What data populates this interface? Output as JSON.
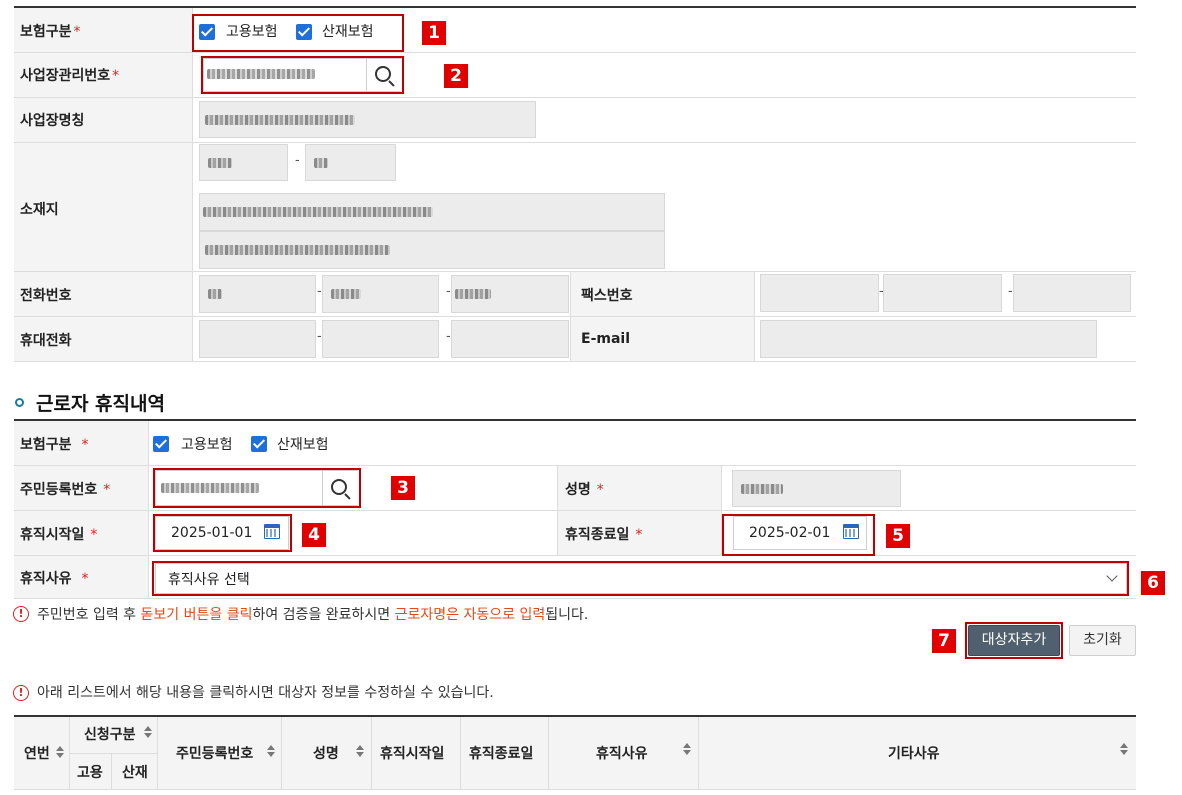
{
  "form1": {
    "insurance_type_label": "보험구분",
    "insurance_options": [
      "고용보험",
      "산재보험"
    ],
    "biz_no_label": "사업장관리번호",
    "biz_name_label": "사업장명칭",
    "address_label": "소재지",
    "phone_label": "전화번호",
    "fax_label": "팩스번호",
    "mobile_label": "휴대전화",
    "email_label": "E-mail",
    "required_mark": "*",
    "dash": "-"
  },
  "section2": {
    "title": "근로자 휴직내역",
    "insurance_type_label": "보험구분",
    "insurance_options": [
      "고용보험",
      "산재보험"
    ],
    "resident_no_label": "주민등록번호",
    "name_label": "성명",
    "leave_start_label": "휴직시작일",
    "leave_start_value": "2025-01-01",
    "leave_end_label": "휴직종료일",
    "leave_end_value": "2025-02-01",
    "leave_reason_label": "휴직사유",
    "leave_reason_value": "휴직사유 선택"
  },
  "notice1": {
    "part1": "주민번호 입력 후 ",
    "highlight1": "돋보기 버튼을 클릭",
    "part2": "하여 검증을 완료하시면 ",
    "highlight2": "근로자명은 자동으로 입력",
    "part3": "됩니다."
  },
  "buttons": {
    "add_target": "대상자추가",
    "reset": "초기화"
  },
  "notice2": "아래 리스트에서 해당 내용을 클릭하시면 대상자 정보를 수정하실 수 있습니다.",
  "table": {
    "headers": {
      "seq": "연번",
      "apply_type": "신청구분",
      "employment": "고용",
      "industrial": "산재",
      "resident_no": "주민등록번호",
      "name": "성명",
      "leave_start": "휴직시작일",
      "leave_end": "휴직종료일",
      "leave_reason": "휴직사유",
      "other_reason": "기타사유"
    }
  },
  "badges": [
    "1",
    "2",
    "3",
    "4",
    "5",
    "6",
    "7"
  ],
  "colors": {
    "accent_red": "#c00000",
    "badge_red": "#e00000",
    "checkbox_blue": "#1e6fd9",
    "highlight_orange": "#e24a1a",
    "primary_button": "#50606e"
  }
}
